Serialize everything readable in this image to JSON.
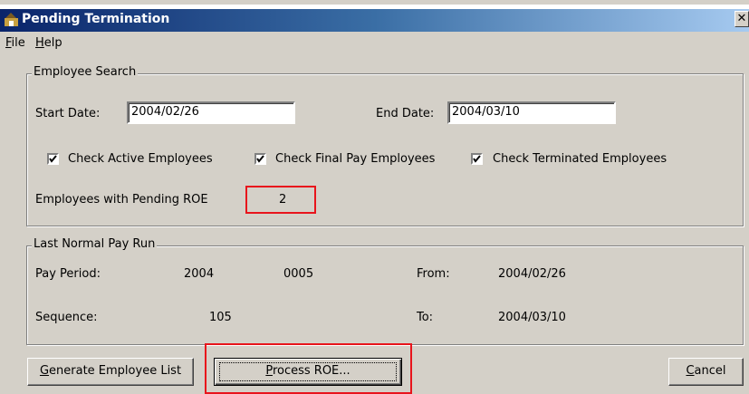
{
  "window": {
    "title": "Pending Termination",
    "close_glyph": "✕"
  },
  "menu": [
    {
      "accel": "F",
      "rest": "ile"
    },
    {
      "accel": "H",
      "rest": "elp"
    }
  ],
  "employee_search": {
    "label": "Employee Search",
    "start_date_label": "Start Date:",
    "start_date_value": "2004/02/26",
    "end_date_label": "End Date:",
    "end_date_value": "2004/03/10",
    "checks": [
      {
        "label": "Check Active Employees",
        "checked": true
      },
      {
        "label": "Check Final Pay Employees",
        "checked": true
      },
      {
        "label": "Check Terminated Employees",
        "checked": true
      }
    ],
    "pending_label": "Employees with Pending ROE",
    "pending_count": "2"
  },
  "last_pay_run": {
    "label": "Last Normal Pay Run",
    "pay_period_label": "Pay Period:",
    "pay_period_year": "2004",
    "pay_period_number": "0005",
    "from_label": "From:",
    "from_value": "2004/02/26",
    "sequence_label": "Sequence:",
    "sequence_value": "105",
    "to_label": "To:",
    "to_value": "2004/03/10"
  },
  "buttons": {
    "generate": {
      "accel": "G",
      "rest": "enerate Employee List"
    },
    "process": {
      "accel": "P",
      "rest": "rocess ROE..."
    },
    "cancel": {
      "accel": "C",
      "rest": "ancel"
    }
  },
  "colors": {
    "highlight": "#e8141c",
    "titlebar": "#0a246a",
    "face": "#d4d0c8"
  }
}
